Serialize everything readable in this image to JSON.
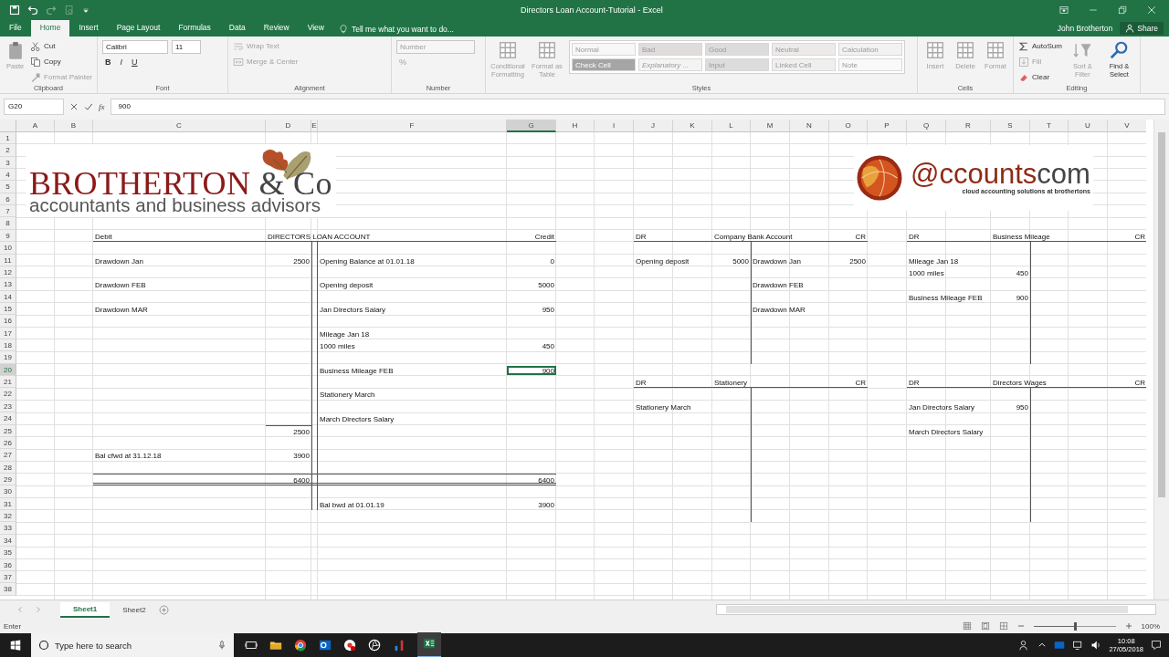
{
  "window": {
    "title": "Directors Loan Account-Tutorial - Excel",
    "user": "John Brotherton",
    "share": "Share"
  },
  "tabs": [
    {
      "label": "File",
      "selected": false
    },
    {
      "label": "Home",
      "selected": true
    },
    {
      "label": "Insert",
      "selected": false
    },
    {
      "label": "Page Layout",
      "selected": false
    },
    {
      "label": "Formulas",
      "selected": false
    },
    {
      "label": "Data",
      "selected": false
    },
    {
      "label": "Review",
      "selected": false
    },
    {
      "label": "View",
      "selected": false
    }
  ],
  "tell_me": {
    "placeholder": "Tell me what you want to do..."
  },
  "ribbon": {
    "groups": [
      {
        "label": "Clipboard",
        "items": [
          {
            "kind": "large",
            "label": "Paste",
            "disabled": true
          },
          {
            "kind": "stack",
            "rows": [
              {
                "controls": [
                  {
                    "kind": "small",
                    "label": "Cut",
                    "disabled": false
                  }
                ]
              },
              {
                "controls": [
                  {
                    "kind": "small",
                    "label": "Copy",
                    "disabled": false
                  }
                ]
              },
              {
                "controls": [
                  {
                    "kind": "small",
                    "label": "Format Painter",
                    "disabled": true
                  }
                ]
              }
            ]
          }
        ]
      },
      {
        "label": "Font",
        "items": [
          {
            "kind": "stack",
            "rows": [
              {
                "controls": [
                  {
                    "kind": "field",
                    "value": "Calibri",
                    "disabled": false
                  },
                  {
                    "kind": "field",
                    "value": "11",
                    "disabled": false
                  }
                ]
              },
              {
                "controls": [
                  {
                    "kind": "bold",
                    "label": "B",
                    "disabled": false
                  },
                  {
                    "kind": "italic",
                    "label": "I",
                    "disabled": false
                  },
                  {
                    "kind": "underline",
                    "label": "U",
                    "disabled": false
                  }
                ]
              }
            ]
          }
        ]
      },
      {
        "label": "Alignment",
        "items": [
          {
            "kind": "stack",
            "rows": [
              {
                "controls": [
                  {
                    "kind": "small",
                    "label": "Wrap Text",
                    "disabled": true
                  }
                ]
              },
              {
                "controls": [
                  {
                    "kind": "small",
                    "label": "Merge & Center",
                    "disabled": true
                  }
                ]
              }
            ]
          }
        ]
      },
      {
        "label": "Number",
        "items": [
          {
            "kind": "stack",
            "rows": [
              {
                "controls": [
                  {
                    "kind": "field",
                    "value": "Number",
                    "disabled": true
                  }
                ]
              },
              {
                "controls": [
                  {
                    "kind": "glyph",
                    "label": "%",
                    "disabled": true
                  }
                ]
              }
            ]
          }
        ]
      },
      {
        "label": "Styles",
        "items": [
          {
            "kind": "large",
            "label": "Conditional Formatting",
            "disabled": true
          },
          {
            "kind": "large",
            "label": "Format as Table",
            "disabled": true
          },
          {
            "kind": "gallery",
            "styles": [
              {
                "label": "Normal",
                "color": "#f7f7f7",
                "italic": false
              },
              {
                "label": "Bad",
                "color": "#e0dcdc",
                "italic": false
              },
              {
                "label": "Good",
                "color": "#dcdcdc",
                "italic": false
              },
              {
                "label": "Neutral",
                "color": "#eeeaea",
                "italic": false
              },
              {
                "label": "Calculation",
                "color": "#f2f2f2",
                "italic": false
              },
              {
                "label": "Check Cell",
                "color": "#a5a5a5",
                "italic": false
              },
              {
                "label": "Explanatory ...",
                "color": "#f4f4f4",
                "italic": true
              },
              {
                "label": "Input",
                "color": "#dcdcdc",
                "italic": false
              },
              {
                "label": "Linked Cell",
                "color": "#f0eeee",
                "italic": false
              },
              {
                "label": "Note",
                "color": "#f9f9f9",
                "italic": false
              }
            ]
          }
        ]
      },
      {
        "label": "Cells",
        "items": [
          {
            "kind": "large",
            "label": "Insert",
            "disabled": true
          },
          {
            "kind": "large",
            "label": "Delete",
            "disabled": true
          },
          {
            "kind": "large",
            "label": "Format",
            "disabled": true
          }
        ]
      },
      {
        "label": "Editing",
        "items": [
          {
            "kind": "stack",
            "rows": [
              {
                "controls": [
                  {
                    "kind": "small",
                    "label": "AutoSum",
                    "disabled": false
                  }
                ]
              },
              {
                "controls": [
                  {
                    "kind": "small",
                    "label": "Fill",
                    "disabled": true
                  }
                ]
              },
              {
                "controls": [
                  {
                    "kind": "small",
                    "label": "Clear",
                    "disabled": false
                  }
                ]
              }
            ]
          },
          {
            "kind": "large",
            "label": "Sort & Filter",
            "disabled": true
          },
          {
            "kind": "large",
            "label": "Find & Select",
            "disabled": false
          }
        ]
      }
    ]
  },
  "formula_bar": {
    "name_box": "G20",
    "fx": "fx",
    "formula": "900"
  },
  "sheet": {
    "columns": [
      "A",
      "B",
      "C",
      "D",
      "E",
      "F",
      "G",
      "H",
      "I",
      "J",
      "K",
      "L",
      "M",
      "N",
      "O",
      "P",
      "Q",
      "R",
      "S",
      "T",
      "U",
      "V"
    ],
    "logos": [
      {
        "kind": "brotherton",
        "name": "BROTHERTON",
        "suffix": "& Co",
        "tagline": "accountants and business advisors"
      },
      {
        "kind": "accountscom",
        "name": "@ccounts",
        "suffix": "com",
        "tagline": "cloud accounting solutions at brothertons"
      }
    ],
    "rows": [
      {
        "header": "1"
      },
      {
        "header": "2"
      },
      {
        "header": "3"
      },
      {
        "header": "4"
      },
      {
        "header": "5"
      },
      {
        "header": "6"
      },
      {
        "header": "7"
      },
      {
        "header": "8"
      },
      {
        "header": "9",
        "cells": [
          "",
          "",
          {
            "text": "Debit",
            "kind": "text",
            "selected": false
          },
          {
            "text": "DIRECTORS LOAN ACCOUNT",
            "kind": "text",
            "selected": false
          },
          "",
          "",
          {
            "text": "Credit",
            "kind": "right",
            "selected": false
          },
          "",
          "",
          {
            "text": "DR",
            "kind": "text",
            "selected": false
          },
          "",
          {
            "text": "Company Bank Account",
            "kind": "text",
            "selected": false
          },
          "",
          "",
          {
            "text": "CR",
            "kind": "right",
            "selected": false
          },
          "",
          {
            "text": "DR",
            "kind": "text",
            "selected": false
          },
          "",
          {
            "text": "Business Mileage",
            "kind": "text",
            "selected": false
          },
          "",
          "",
          {
            "text": "CR",
            "kind": "right",
            "selected": false
          }
        ]
      },
      {
        "header": "10"
      },
      {
        "header": "11",
        "cells": [
          "",
          "",
          {
            "text": "Drawdown Jan",
            "kind": "text",
            "selected": false
          },
          {
            "text": "2500",
            "kind": "number",
            "selected": false
          },
          "",
          {
            "text": "Opening Balance at 01.01.18",
            "kind": "text",
            "selected": false
          },
          {
            "text": "0",
            "kind": "number",
            "selected": false
          },
          "",
          "",
          {
            "text": "Opening deposit",
            "kind": "text",
            "selected": false
          },
          "",
          {
            "text": "5000",
            "kind": "number",
            "selected": false
          },
          {
            "text": "Drawdown Jan",
            "kind": "text",
            "selected": false
          },
          "",
          {
            "text": "2500",
            "kind": "number",
            "selected": false
          },
          "",
          {
            "text": "Mileage Jan 18",
            "kind": "text",
            "selected": false
          }
        ]
      },
      {
        "header": "12",
        "cells": [
          "",
          "",
          "",
          "",
          "",
          "",
          "",
          "",
          "",
          "",
          "",
          "",
          "",
          "",
          "",
          "",
          {
            "text": "1000 miles",
            "kind": "text",
            "selected": false
          },
          "",
          {
            "text": "450",
            "kind": "number",
            "selected": false
          }
        ]
      },
      {
        "header": "13",
        "cells": [
          "",
          "",
          {
            "text": "Drawdown FEB",
            "kind": "text",
            "selected": false
          },
          "",
          "",
          {
            "text": "Opening deposit",
            "kind": "text",
            "selected": false
          },
          {
            "text": "5000",
            "kind": "number",
            "selected": false
          },
          "",
          "",
          "",
          "",
          "",
          {
            "text": "Drawdown FEB",
            "kind": "text",
            "selected": false
          }
        ]
      },
      {
        "header": "14",
        "cells": [
          "",
          "",
          "",
          "",
          "",
          "",
          "",
          "",
          "",
          "",
          "",
          "",
          "",
          "",
          "",
          "",
          {
            "text": "Business Mileage FEB",
            "kind": "text",
            "selected": false
          },
          "",
          {
            "text": "900",
            "kind": "number",
            "selected": false
          }
        ]
      },
      {
        "header": "15",
        "cells": [
          "",
          "",
          {
            "text": "Drawdown MAR",
            "kind": "text",
            "selected": false
          },
          "",
          "",
          {
            "text": "Jan Directors Salary",
            "kind": "text",
            "selected": false
          },
          {
            "text": "950",
            "kind": "number",
            "selected": false
          },
          "",
          "",
          "",
          "",
          "",
          {
            "text": "Drawdown MAR",
            "kind": "text",
            "selected": false
          }
        ]
      },
      {
        "header": "16"
      },
      {
        "header": "17",
        "cells": [
          "",
          "",
          "",
          "",
          "",
          {
            "text": "Mileage Jan 18",
            "kind": "text",
            "selected": false
          }
        ]
      },
      {
        "header": "18",
        "cells": [
          "",
          "",
          "",
          "",
          "",
          {
            "text": "1000 miles",
            "kind": "text",
            "selected": false
          },
          {
            "text": "450",
            "kind": "number",
            "selected": false
          }
        ]
      },
      {
        "header": "19"
      },
      {
        "header": "20",
        "cells": [
          "",
          "",
          "",
          "",
          "",
          {
            "text": "Business Mileage FEB",
            "kind": "text",
            "selected": false
          },
          {
            "text": "900",
            "kind": "number",
            "selected": true
          }
        ]
      },
      {
        "header": "21",
        "cells": [
          "",
          "",
          "",
          "",
          "",
          "",
          "",
          "",
          "",
          {
            "text": "DR",
            "kind": "text",
            "selected": false
          },
          "",
          {
            "text": "Stationery",
            "kind": "text",
            "selected": false
          },
          "",
          "",
          {
            "text": "CR",
            "kind": "right",
            "selected": false
          },
          "",
          {
            "text": "DR",
            "kind": "text",
            "selected": false
          },
          "",
          {
            "text": "Directors Wages",
            "kind": "text",
            "selected": false
          },
          "",
          "",
          {
            "text": "CR",
            "kind": "right",
            "selected": false
          }
        ]
      },
      {
        "header": "22",
        "cells": [
          "",
          "",
          "",
          "",
          "",
          {
            "text": "Stationery March",
            "kind": "text",
            "selected": false
          }
        ]
      },
      {
        "header": "23",
        "cells": [
          "",
          "",
          "",
          "",
          "",
          "",
          "",
          "",
          "",
          {
            "text": "Stationery March",
            "kind": "text",
            "selected": false
          },
          "",
          "",
          "",
          "",
          "",
          "",
          {
            "text": "Jan Directors Salary",
            "kind": "text",
            "selected": false
          },
          "",
          {
            "text": "950",
            "kind": "number",
            "selected": false
          }
        ]
      },
      {
        "header": "24",
        "cells": [
          "",
          "",
          "",
          "",
          "",
          {
            "text": "March Directors Salary",
            "kind": "text",
            "selected": false
          }
        ]
      },
      {
        "header": "25",
        "cells": [
          "",
          "",
          "",
          {
            "text": "2500",
            "kind": "number",
            "selected": false
          },
          "",
          "",
          "",
          "",
          "",
          "",
          "",
          "",
          "",
          "",
          "",
          "",
          {
            "text": "March Directors Salary",
            "kind": "text",
            "selected": false
          }
        ]
      },
      {
        "header": "26"
      },
      {
        "header": "27",
        "cells": [
          "",
          "",
          {
            "text": "Bal cfwd at 31.12.18",
            "kind": "text",
            "selected": false
          },
          {
            "text": "3900",
            "kind": "number",
            "selected": false
          }
        ]
      },
      {
        "header": "28"
      },
      {
        "header": "29",
        "cells": [
          "",
          "",
          "",
          {
            "text": "6400",
            "kind": "number",
            "selected": false
          },
          "",
          "",
          {
            "text": "6400",
            "kind": "number",
            "selected": false
          }
        ]
      },
      {
        "header": "30"
      },
      {
        "header": "31",
        "cells": [
          "",
          "",
          "",
          "",
          "",
          {
            "text": "Bal bwd at 01.01.19",
            "kind": "text",
            "selected": false
          },
          {
            "text": "3900",
            "kind": "number",
            "selected": false
          }
        ]
      },
      {
        "header": "32"
      },
      {
        "header": "33"
      },
      {
        "header": "34"
      },
      {
        "header": "35"
      },
      {
        "header": "36"
      },
      {
        "header": "37"
      },
      {
        "header": "38"
      }
    ]
  },
  "sheet_tabs": [
    {
      "label": "Sheet1",
      "selected": true
    },
    {
      "label": "Sheet2",
      "selected": false
    }
  ],
  "status_bar": {
    "mode": "Enter",
    "zoom": {
      "reading": "100%",
      "level": 0.5
    }
  },
  "taskbar": {
    "search_placeholder": "Type here to search",
    "time": "10:08",
    "date": "27/05/2018"
  }
}
